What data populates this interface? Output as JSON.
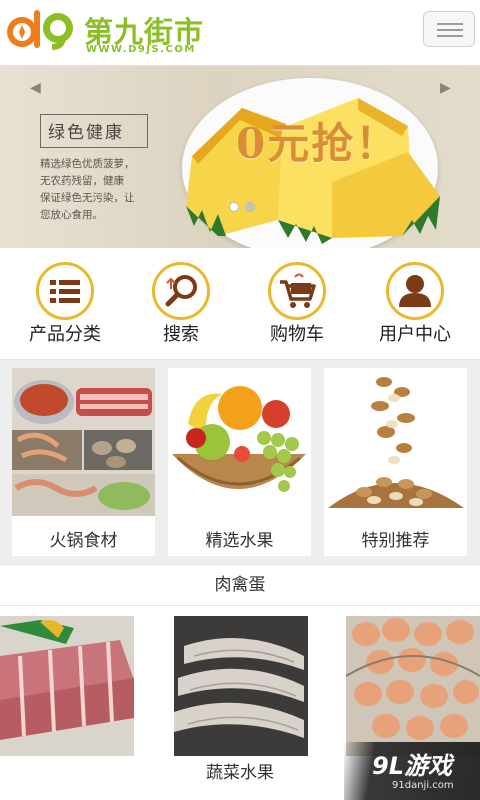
{
  "header": {
    "logo_title": "第九街市",
    "logo_url": "WWW.D9JS.COM",
    "menu_icon": "hamburger-menu-icon"
  },
  "banner": {
    "heading": "绿色健康",
    "lines": [
      "精选绿色优质菠萝，",
      "无农药残留，健康",
      "保证绿色无污染，让",
      "您放心食用。"
    ],
    "promo": "0元抢！",
    "slide_count": 2,
    "active_slide": 1
  },
  "quick_nav": [
    {
      "label": "产品分类",
      "icon": "list-icon"
    },
    {
      "label": "搜索",
      "icon": "search-icon"
    },
    {
      "label": "购物车",
      "icon": "cart-icon"
    },
    {
      "label": "用户中心",
      "icon": "user-icon"
    }
  ],
  "categories": [
    {
      "label": "火锅食材",
      "image": "hotpot-ingredients-image"
    },
    {
      "label": "精选水果",
      "image": "fruit-basket-image"
    },
    {
      "label": "特别推荐",
      "image": "nuts-image"
    }
  ],
  "sections": {
    "meat_title": "肉禽蛋",
    "veg_title": "蔬菜水果"
  },
  "products": [
    {
      "image": "pork-ribs-image"
    },
    {
      "image": "shrimp-image"
    },
    {
      "image": "eggs-image"
    }
  ],
  "watermark": {
    "main": "9L游戏",
    "sub": "91danji.com"
  },
  "colors": {
    "brand_green": "#8cbf26",
    "brand_orange": "#ef7d1a",
    "icon_gold": "#e9b92b",
    "icon_brown": "#7a3b16"
  }
}
